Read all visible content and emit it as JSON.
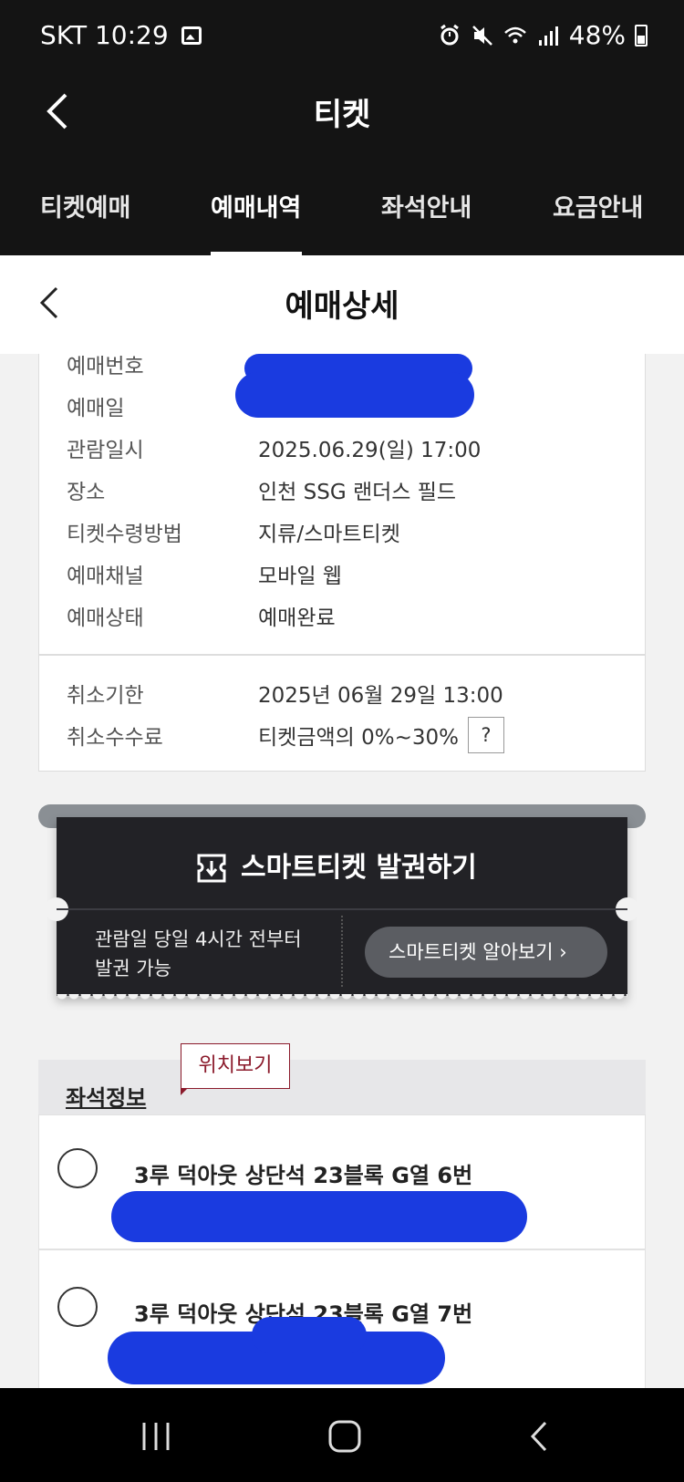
{
  "status_bar": {
    "carrier_time": "SKT 10:29",
    "battery": "48%"
  },
  "header": {
    "title": "티켓",
    "tabs": [
      {
        "label": "티켓예매",
        "active": false
      },
      {
        "label": "예매내역",
        "active": true
      },
      {
        "label": "좌석안내",
        "active": false
      },
      {
        "label": "요금안내",
        "active": false
      }
    ]
  },
  "subheader": {
    "title": "예매상세"
  },
  "booking_info": [
    {
      "label": "예매번호",
      "value": ""
    },
    {
      "label": "예매일",
      "value": ""
    },
    {
      "label": "관람일시",
      "value": "2025.06.29(일) 17:00"
    },
    {
      "label": "장소",
      "value": "인천 SSG 랜더스 필드"
    },
    {
      "label": "티켓수령방법",
      "value": "지류/스마트티켓"
    },
    {
      "label": "예매채널",
      "value": "모바일 웹"
    },
    {
      "label": "예매상태",
      "value": "예매완료"
    }
  ],
  "cancel_info": [
    {
      "label": "취소기한",
      "value": "2025년 06월 29일 13:00"
    },
    {
      "label": "취소수수료",
      "value": "티켓금액의 0%~30%"
    }
  ],
  "help_button": "?",
  "smart_ticket": {
    "title": "스마트티켓 발권하기",
    "note": "관람일 당일 4시간 전부터 발권 가능",
    "link": "스마트티켓 알아보기 ›"
  },
  "seat_info": {
    "title": "좌석정보",
    "location_button": "위치보기",
    "seats": [
      "3루 덕아웃 상단석 23블록 G열 6번",
      "3루 덕아웃 상단석 23블록 G열 7번"
    ]
  }
}
